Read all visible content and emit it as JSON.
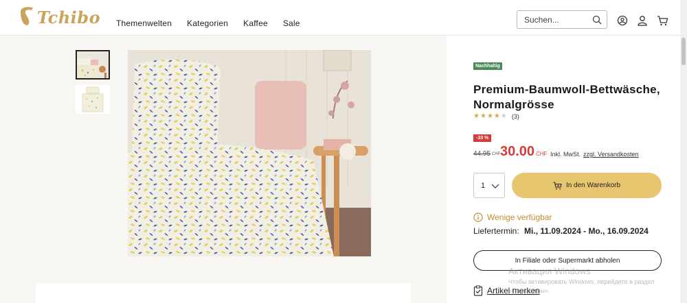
{
  "brand": {
    "logo_text": "Tchibo",
    "color": "#c9a45c"
  },
  "nav": {
    "items": [
      "Themenwelten",
      "Kategorien",
      "Kaffee",
      "Sale"
    ]
  },
  "search": {
    "placeholder": "Suchen..."
  },
  "header_icons": [
    "search-icon",
    "account-switch-icon",
    "user-icon",
    "cart-icon"
  ],
  "product": {
    "badge": "Nachhaltig",
    "title": "Premium-Baumwoll-Bettwäsche, Normalgrösse",
    "rating": {
      "stars_filled": 4,
      "stars_total": 5,
      "count": "(3)"
    },
    "discount": "-33 %",
    "old_price": "44.95",
    "old_currency": "CHF",
    "price": "30.00",
    "currency": "CHF",
    "vat_text": "Inkl. MwSt.",
    "shipping_link": "zzgl. Versandkosten",
    "quantity": "1",
    "add_to_cart": "In den Warenkorb",
    "availability": "Wenige verfügbar",
    "delivery_label": "Liefertermin:",
    "delivery_dates": "Mi., 11.09.2024 - Mo., 16.09.2024",
    "store_pickup": "In Filiale oder Supermarkt abholen",
    "bookmark": "Artikel merken"
  },
  "colors": {
    "accent": "#e8c56f",
    "sale": "#d63b3b",
    "eco": "#4c8b57",
    "availability": "#c88a2e"
  },
  "windows_watermark": {
    "title": "Активация Windows",
    "text": "Чтобы активировать Windows, перейдите в раздел «Параметры»."
  }
}
